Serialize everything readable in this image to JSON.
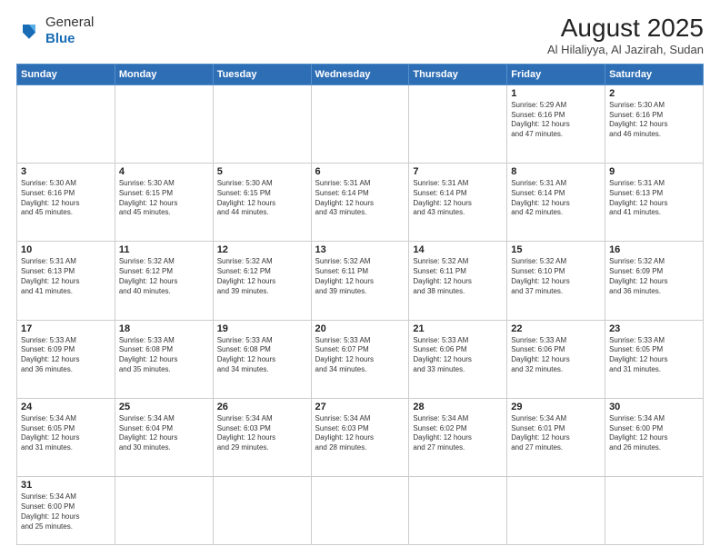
{
  "header": {
    "logo_general": "General",
    "logo_blue": "Blue",
    "title": "August 2025",
    "subtitle": "Al Hilaliyya, Al Jazirah, Sudan"
  },
  "columns": [
    "Sunday",
    "Monday",
    "Tuesday",
    "Wednesday",
    "Thursday",
    "Friday",
    "Saturday"
  ],
  "weeks": [
    [
      {
        "day": "",
        "info": ""
      },
      {
        "day": "",
        "info": ""
      },
      {
        "day": "",
        "info": ""
      },
      {
        "day": "",
        "info": ""
      },
      {
        "day": "",
        "info": ""
      },
      {
        "day": "1",
        "info": "Sunrise: 5:29 AM\nSunset: 6:16 PM\nDaylight: 12 hours\nand 47 minutes."
      },
      {
        "day": "2",
        "info": "Sunrise: 5:30 AM\nSunset: 6:16 PM\nDaylight: 12 hours\nand 46 minutes."
      }
    ],
    [
      {
        "day": "3",
        "info": "Sunrise: 5:30 AM\nSunset: 6:16 PM\nDaylight: 12 hours\nand 45 minutes."
      },
      {
        "day": "4",
        "info": "Sunrise: 5:30 AM\nSunset: 6:15 PM\nDaylight: 12 hours\nand 45 minutes."
      },
      {
        "day": "5",
        "info": "Sunrise: 5:30 AM\nSunset: 6:15 PM\nDaylight: 12 hours\nand 44 minutes."
      },
      {
        "day": "6",
        "info": "Sunrise: 5:31 AM\nSunset: 6:14 PM\nDaylight: 12 hours\nand 43 minutes."
      },
      {
        "day": "7",
        "info": "Sunrise: 5:31 AM\nSunset: 6:14 PM\nDaylight: 12 hours\nand 43 minutes."
      },
      {
        "day": "8",
        "info": "Sunrise: 5:31 AM\nSunset: 6:14 PM\nDaylight: 12 hours\nand 42 minutes."
      },
      {
        "day": "9",
        "info": "Sunrise: 5:31 AM\nSunset: 6:13 PM\nDaylight: 12 hours\nand 41 minutes."
      }
    ],
    [
      {
        "day": "10",
        "info": "Sunrise: 5:31 AM\nSunset: 6:13 PM\nDaylight: 12 hours\nand 41 minutes."
      },
      {
        "day": "11",
        "info": "Sunrise: 5:32 AM\nSunset: 6:12 PM\nDaylight: 12 hours\nand 40 minutes."
      },
      {
        "day": "12",
        "info": "Sunrise: 5:32 AM\nSunset: 6:12 PM\nDaylight: 12 hours\nand 39 minutes."
      },
      {
        "day": "13",
        "info": "Sunrise: 5:32 AM\nSunset: 6:11 PM\nDaylight: 12 hours\nand 39 minutes."
      },
      {
        "day": "14",
        "info": "Sunrise: 5:32 AM\nSunset: 6:11 PM\nDaylight: 12 hours\nand 38 minutes."
      },
      {
        "day": "15",
        "info": "Sunrise: 5:32 AM\nSunset: 6:10 PM\nDaylight: 12 hours\nand 37 minutes."
      },
      {
        "day": "16",
        "info": "Sunrise: 5:32 AM\nSunset: 6:09 PM\nDaylight: 12 hours\nand 36 minutes."
      }
    ],
    [
      {
        "day": "17",
        "info": "Sunrise: 5:33 AM\nSunset: 6:09 PM\nDaylight: 12 hours\nand 36 minutes."
      },
      {
        "day": "18",
        "info": "Sunrise: 5:33 AM\nSunset: 6:08 PM\nDaylight: 12 hours\nand 35 minutes."
      },
      {
        "day": "19",
        "info": "Sunrise: 5:33 AM\nSunset: 6:08 PM\nDaylight: 12 hours\nand 34 minutes."
      },
      {
        "day": "20",
        "info": "Sunrise: 5:33 AM\nSunset: 6:07 PM\nDaylight: 12 hours\nand 34 minutes."
      },
      {
        "day": "21",
        "info": "Sunrise: 5:33 AM\nSunset: 6:06 PM\nDaylight: 12 hours\nand 33 minutes."
      },
      {
        "day": "22",
        "info": "Sunrise: 5:33 AM\nSunset: 6:06 PM\nDaylight: 12 hours\nand 32 minutes."
      },
      {
        "day": "23",
        "info": "Sunrise: 5:33 AM\nSunset: 6:05 PM\nDaylight: 12 hours\nand 31 minutes."
      }
    ],
    [
      {
        "day": "24",
        "info": "Sunrise: 5:34 AM\nSunset: 6:05 PM\nDaylight: 12 hours\nand 31 minutes."
      },
      {
        "day": "25",
        "info": "Sunrise: 5:34 AM\nSunset: 6:04 PM\nDaylight: 12 hours\nand 30 minutes."
      },
      {
        "day": "26",
        "info": "Sunrise: 5:34 AM\nSunset: 6:03 PM\nDaylight: 12 hours\nand 29 minutes."
      },
      {
        "day": "27",
        "info": "Sunrise: 5:34 AM\nSunset: 6:03 PM\nDaylight: 12 hours\nand 28 minutes."
      },
      {
        "day": "28",
        "info": "Sunrise: 5:34 AM\nSunset: 6:02 PM\nDaylight: 12 hours\nand 27 minutes."
      },
      {
        "day": "29",
        "info": "Sunrise: 5:34 AM\nSunset: 6:01 PM\nDaylight: 12 hours\nand 27 minutes."
      },
      {
        "day": "30",
        "info": "Sunrise: 5:34 AM\nSunset: 6:00 PM\nDaylight: 12 hours\nand 26 minutes."
      }
    ],
    [
      {
        "day": "31",
        "info": "Sunrise: 5:34 AM\nSunset: 6:00 PM\nDaylight: 12 hours\nand 25 minutes."
      },
      {
        "day": "",
        "info": ""
      },
      {
        "day": "",
        "info": ""
      },
      {
        "day": "",
        "info": ""
      },
      {
        "day": "",
        "info": ""
      },
      {
        "day": "",
        "info": ""
      },
      {
        "day": "",
        "info": ""
      }
    ]
  ]
}
